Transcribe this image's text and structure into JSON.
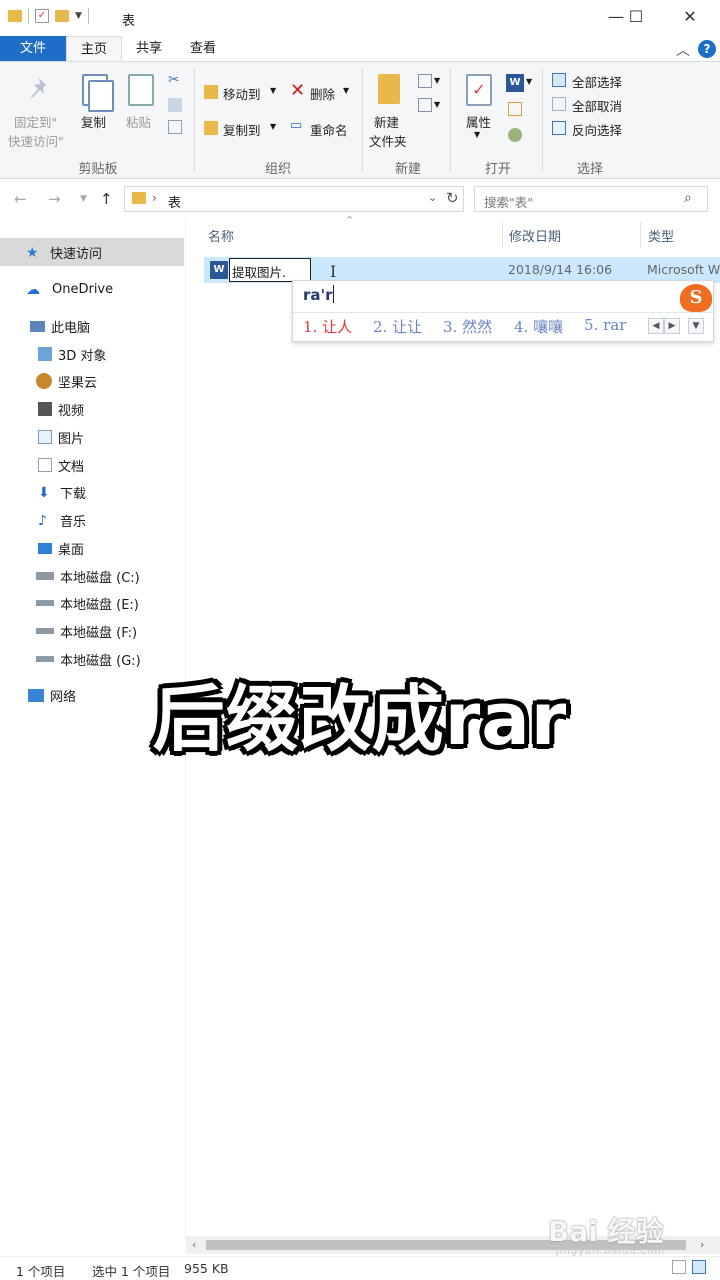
{
  "window": {
    "title": "表"
  },
  "ribbon_tabs": [
    {
      "label": "文件"
    },
    {
      "label": "主页"
    },
    {
      "label": "共享"
    },
    {
      "label": "查看"
    }
  ],
  "ribbon": {
    "clipboard": {
      "pin_line1": "固定到\"",
      "pin_line2": "快速访问\"",
      "copy": "复制",
      "paste": "粘贴",
      "label": "剪贴板"
    },
    "organize": {
      "move_to": "移动到",
      "copy_to": "复制到",
      "delete": "删除",
      "rename": "重命名",
      "label": "组织"
    },
    "new": {
      "new_folder_line1": "新建",
      "new_folder_line2": "文件夹",
      "label": "新建"
    },
    "open": {
      "properties": "属性",
      "label": "打开"
    },
    "select": {
      "select_all": "全部选择",
      "select_none": "全部取消",
      "invert": "反向选择",
      "label": "选择"
    }
  },
  "address": {
    "path": "表"
  },
  "search": {
    "placeholder": "搜索\"表\""
  },
  "sidebar": {
    "quick_access": "快速访问",
    "onedrive": "OneDrive",
    "this_pc": "此电脑",
    "items": [
      {
        "label": "3D 对象"
      },
      {
        "label": "坚果云"
      },
      {
        "label": "视频"
      },
      {
        "label": "图片"
      },
      {
        "label": "文档"
      },
      {
        "label": "下载"
      },
      {
        "label": "音乐"
      },
      {
        "label": "桌面"
      },
      {
        "label": "本地磁盘 (C:)"
      },
      {
        "label": "本地磁盘 (E:)"
      },
      {
        "label": "本地磁盘 (F:)"
      },
      {
        "label": "本地磁盘 (G:)"
      }
    ],
    "network": "网络"
  },
  "list": {
    "columns": {
      "name": "名称",
      "date": "修改日期",
      "type": "类型"
    },
    "rows": [
      {
        "name_edit": "提取图片.",
        "date": "2018/9/14 16:06",
        "type": "Microsoft W"
      }
    ]
  },
  "ime": {
    "input": "ra'r",
    "candidates": [
      "1. 让人",
      "2. 让让",
      "3. 然然",
      "4. 嚷嚷",
      "5. rar"
    ]
  },
  "overlay_caption": "后缀改成rar",
  "status": {
    "count": "1 个项目",
    "selected": "选中 1 个项目",
    "size": "955 KB"
  },
  "watermark": {
    "brand": "Bai 经验",
    "sub": "jingyan.baidu.com"
  }
}
